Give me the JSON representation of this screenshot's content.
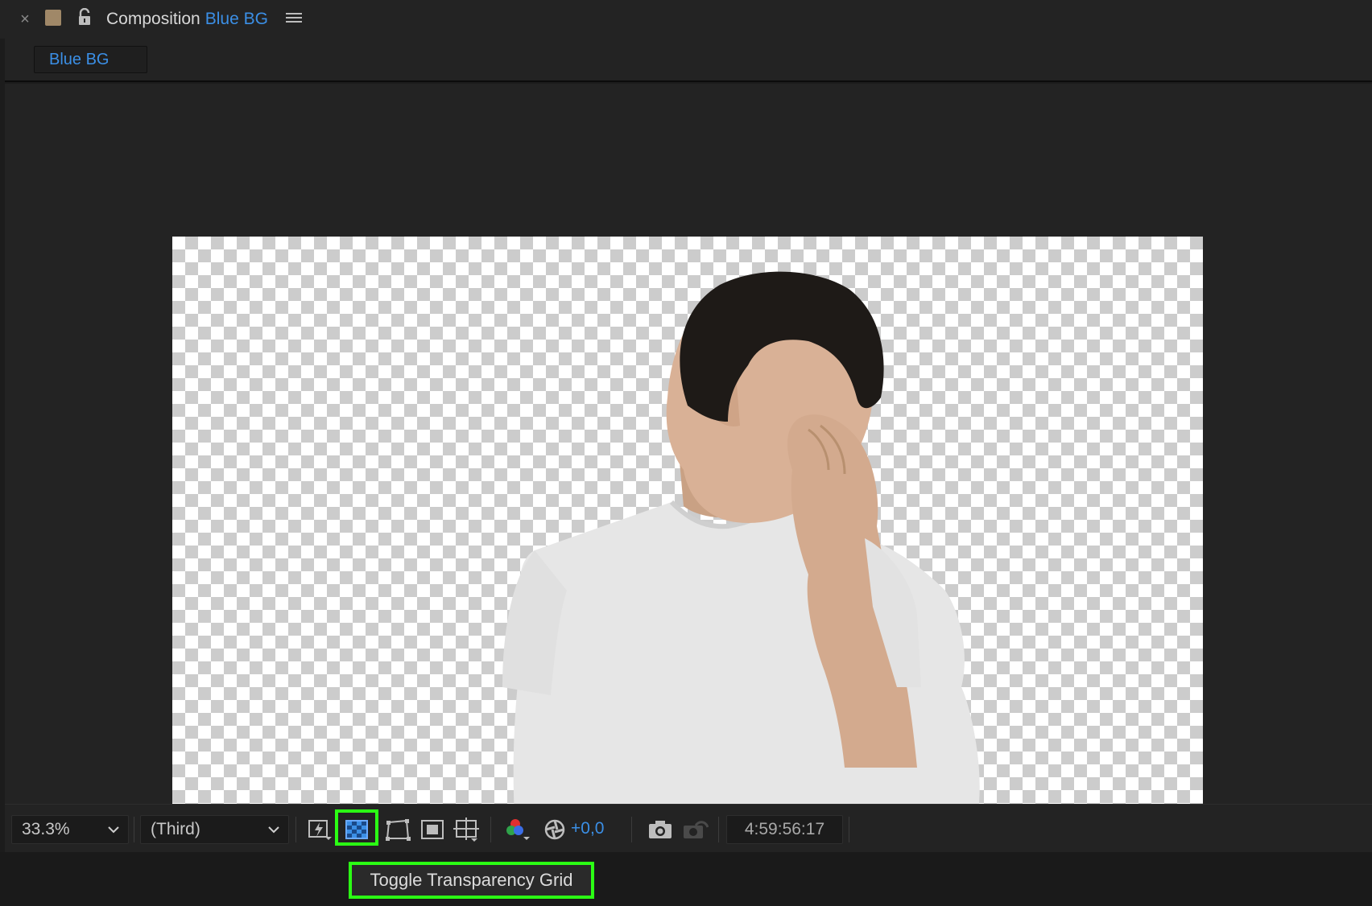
{
  "panel": {
    "close_glyph": "×",
    "title_label": "Composition",
    "composition_name": "Blue BG",
    "label_color": "#a08868",
    "icons": [
      "close-icon",
      "label-color-swatch",
      "lock-open-icon",
      "panel-menu-icon"
    ]
  },
  "tabs": [
    {
      "label": "Blue BG",
      "active": true
    }
  ],
  "viewer": {
    "transparency_grid": true,
    "content": "person-cutout"
  },
  "toolbar": {
    "magnification": "33.3%",
    "resolution": "(Third)",
    "exposure": "+0,0",
    "timecode": "4:59:56:17",
    "icons": [
      "fast-previews-icon",
      "transparency-grid-icon",
      "mask-path-visibility-icon",
      "region-of-interest-icon",
      "grid-guides-icon",
      "color-channels-icon",
      "exposure-reset-icon",
      "snapshot-camera-icon",
      "show-snapshot-icon"
    ],
    "highlighted": "transparency-grid-icon"
  },
  "tooltip": {
    "text": "Toggle Transparency Grid"
  },
  "colors": {
    "accent": "#3b8fe6",
    "highlight": "#2bff14",
    "panel_bg": "#232323"
  }
}
